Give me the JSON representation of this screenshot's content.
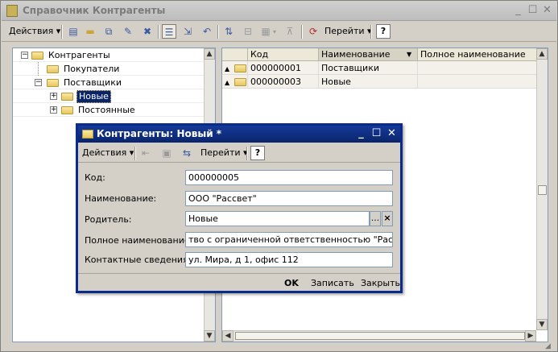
{
  "main_window": {
    "title": "Справочник Контрагенты",
    "toolbar": {
      "actions_label": "Действия",
      "goto_label": "Перейти",
      "help_label": "?"
    }
  },
  "tree": {
    "items": [
      {
        "label": "Контрагенты",
        "expander": "−"
      },
      {
        "label": "Покупатели",
        "expander": ""
      },
      {
        "label": "Поставщики",
        "expander": "−"
      },
      {
        "label": "Новые",
        "expander": "+"
      },
      {
        "label": "Постоянные",
        "expander": "+"
      }
    ]
  },
  "grid": {
    "columns": [
      "Код",
      "Наименование",
      "Полное наименование"
    ],
    "rows": [
      {
        "code": "000000001",
        "name": "Поставщики",
        "full_name": ""
      },
      {
        "code": "000000003",
        "name": "Новые",
        "full_name": ""
      }
    ]
  },
  "dialog": {
    "title": "Контрагенты: Новый *",
    "toolbar": {
      "actions_label": "Действия",
      "goto_label": "Перейти",
      "help_label": "?"
    },
    "fields": {
      "code": {
        "label": "Код:",
        "value": "000000005"
      },
      "name": {
        "label": "Наименование:",
        "value": "ООО \"Рассвет\""
      },
      "parent": {
        "label": "Родитель:",
        "value": "Новые",
        "select_label": "...",
        "clear_label": "×"
      },
      "full_name": {
        "label": "Полное наименование:",
        "value": "тво с ограниченной ответственностью \"Рассвет\""
      },
      "contacts": {
        "label": "Контактные сведения:",
        "value": "ул. Мира, д 1, офис 112"
      }
    },
    "buttons": {
      "ok": "OK",
      "save": "Записать",
      "close": "Закрыть"
    }
  },
  "colors": {
    "dialog_title": "#0a246a",
    "selection": "#0a246a",
    "window_bg": "#d4d0c8"
  }
}
